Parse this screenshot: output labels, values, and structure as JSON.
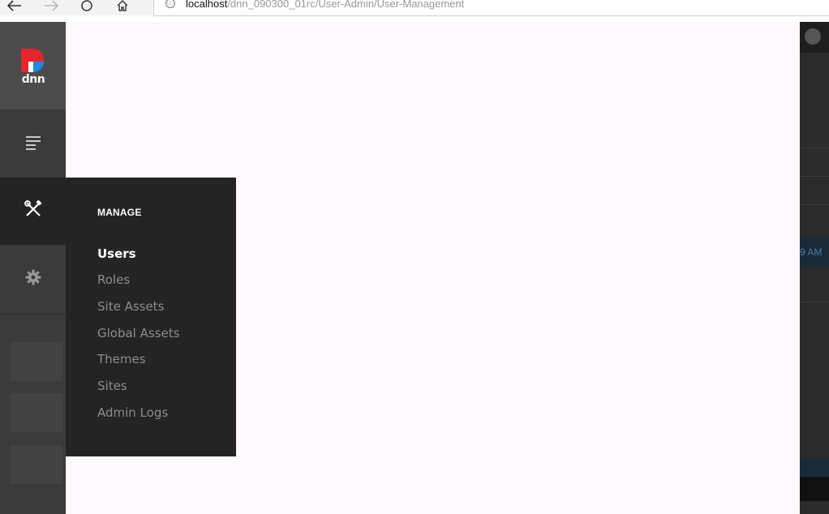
{
  "browser": {
    "url_host": "localhost",
    "url_path": "/dnn_090300_01rc/User-Admin/User-Management",
    "info_icon": "ⓘ"
  },
  "persona_bar": {
    "logo_text": "dnn",
    "items": [
      {
        "icon": "content-icon",
        "active": false
      },
      {
        "icon": "manage-icon",
        "active": true
      },
      {
        "icon": "settings-gear-icon",
        "active": false
      }
    ]
  },
  "flyout": {
    "title": "MANAGE",
    "items": [
      {
        "label": "Users",
        "active": true
      },
      {
        "label": "Roles",
        "active": false
      },
      {
        "label": "Site Assets",
        "active": false
      },
      {
        "label": "Global Assets",
        "active": false
      },
      {
        "label": "Themes",
        "active": false
      },
      {
        "label": "Sites",
        "active": false
      },
      {
        "label": "Admin Logs",
        "active": false
      }
    ]
  },
  "right_strip": {
    "time_fragment": "9 AM"
  },
  "colors": {
    "persona_bg": "#3a3b3a",
    "flyout_bg": "#232423",
    "content_bg": "#fdf9fc",
    "logo_red": "#e5262b",
    "logo_blue": "#1f8be0"
  }
}
